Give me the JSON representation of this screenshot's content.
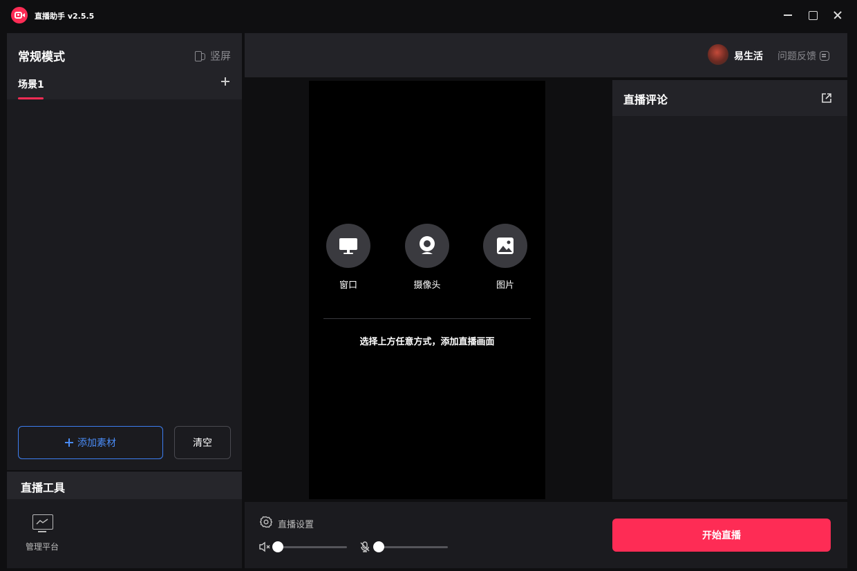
{
  "app": {
    "title": "直播助手 v2.5.5"
  },
  "left": {
    "mode_title": "常规模式",
    "portrait_label": "竖屏",
    "scene_tab": "场景1",
    "add_material": "添加素材",
    "clear": "清空"
  },
  "tools": {
    "title": "直播工具",
    "items": [
      {
        "label": "管理平台",
        "icon": "monitor-chart-icon"
      }
    ]
  },
  "header": {
    "username": "易生活",
    "feedback": "问题反馈"
  },
  "preview": {
    "sources": [
      {
        "label": "窗口",
        "icon": "monitor-icon"
      },
      {
        "label": "摄像头",
        "icon": "webcam-icon"
      },
      {
        "label": "图片",
        "icon": "image-icon"
      }
    ],
    "hint": "选择上方任意方式，添加直播画面"
  },
  "comments": {
    "title": "直播评论"
  },
  "bottom": {
    "settings_label": "直播设置",
    "speaker_volume": 0,
    "mic_volume": 0,
    "start_label": "开始直播"
  },
  "colors": {
    "accent": "#fe2c55",
    "blue": "#4a8cf7",
    "panel": "#1b1b1f"
  }
}
